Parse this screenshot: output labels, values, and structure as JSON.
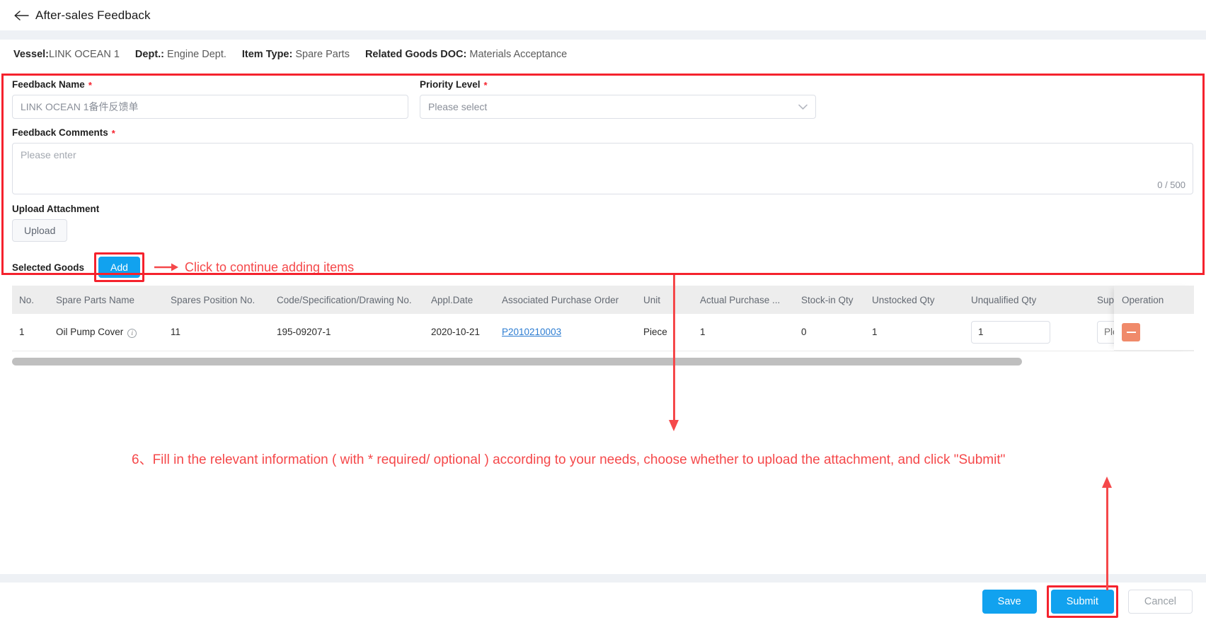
{
  "header": {
    "back_icon": "back-arrow-icon",
    "title": "After-sales Feedback"
  },
  "meta": [
    {
      "key": "Vessel:",
      "value": "LINK OCEAN 1"
    },
    {
      "key": "Dept.:",
      "value": "Engine Dept."
    },
    {
      "key": "Item Type:",
      "value": "Spare Parts"
    },
    {
      "key": "Related Goods DOC:",
      "value": "Materials Acceptance"
    }
  ],
  "form": {
    "feedback_name_label": "Feedback Name",
    "feedback_name_value": "LINK OCEAN 1备件反馈单",
    "priority_label": "Priority Level",
    "priority_placeholder": "Please select",
    "comments_label": "Feedback Comments",
    "comments_placeholder": "Please enter",
    "comments_counter": "0 / 500",
    "upload_label": "Upload Attachment",
    "upload_button": "Upload",
    "required_mark": "*"
  },
  "goods": {
    "section_title": "Selected Goods",
    "add_button": "Add",
    "add_annotation": "Click to continue adding items",
    "columns": [
      "No.",
      "Spare Parts Name",
      "Spares Position No.",
      "Code/Specification/Drawing No.",
      "Appl.Date",
      "Associated Purchase Order",
      "Unit",
      "Actual Purchase ...",
      "Stock-in Qty",
      "Unstocked Qty",
      "Unqualified Qty",
      "Supp"
    ],
    "operation_column": "Operation",
    "rows": [
      {
        "no": "1",
        "name": "Oil Pump Cover",
        "name_info_icon": "info-circle-icon",
        "position_no": "11",
        "code": "195-09207-1",
        "appl_date": "2020-10-21",
        "purchase_order": "P2010210003",
        "unit": "Piece",
        "actual_purchase": "1",
        "stock_in_qty": "0",
        "unstocked_qty": "1",
        "unqualified_qty": "1",
        "supplier_placeholder": "Plea",
        "operation_icon": "minus-icon"
      }
    ]
  },
  "annotations": {
    "step_text": "6、Fill in the relevant information ( with * required/ optional ) according to your needs, choose whether to upload the attachment, and click \"Submit\""
  },
  "footer": {
    "save": "Save",
    "submit": "Submit",
    "cancel": "Cancel"
  },
  "colors": {
    "accent_blue": "#11a2ef",
    "annotation_red": "#f5484a",
    "box_red": "#f5222d",
    "minus_orange": "#f08a6a",
    "link_blue": "#2d7dd2",
    "band_gray": "#eef1f5",
    "table_head_gray": "#ededed"
  }
}
